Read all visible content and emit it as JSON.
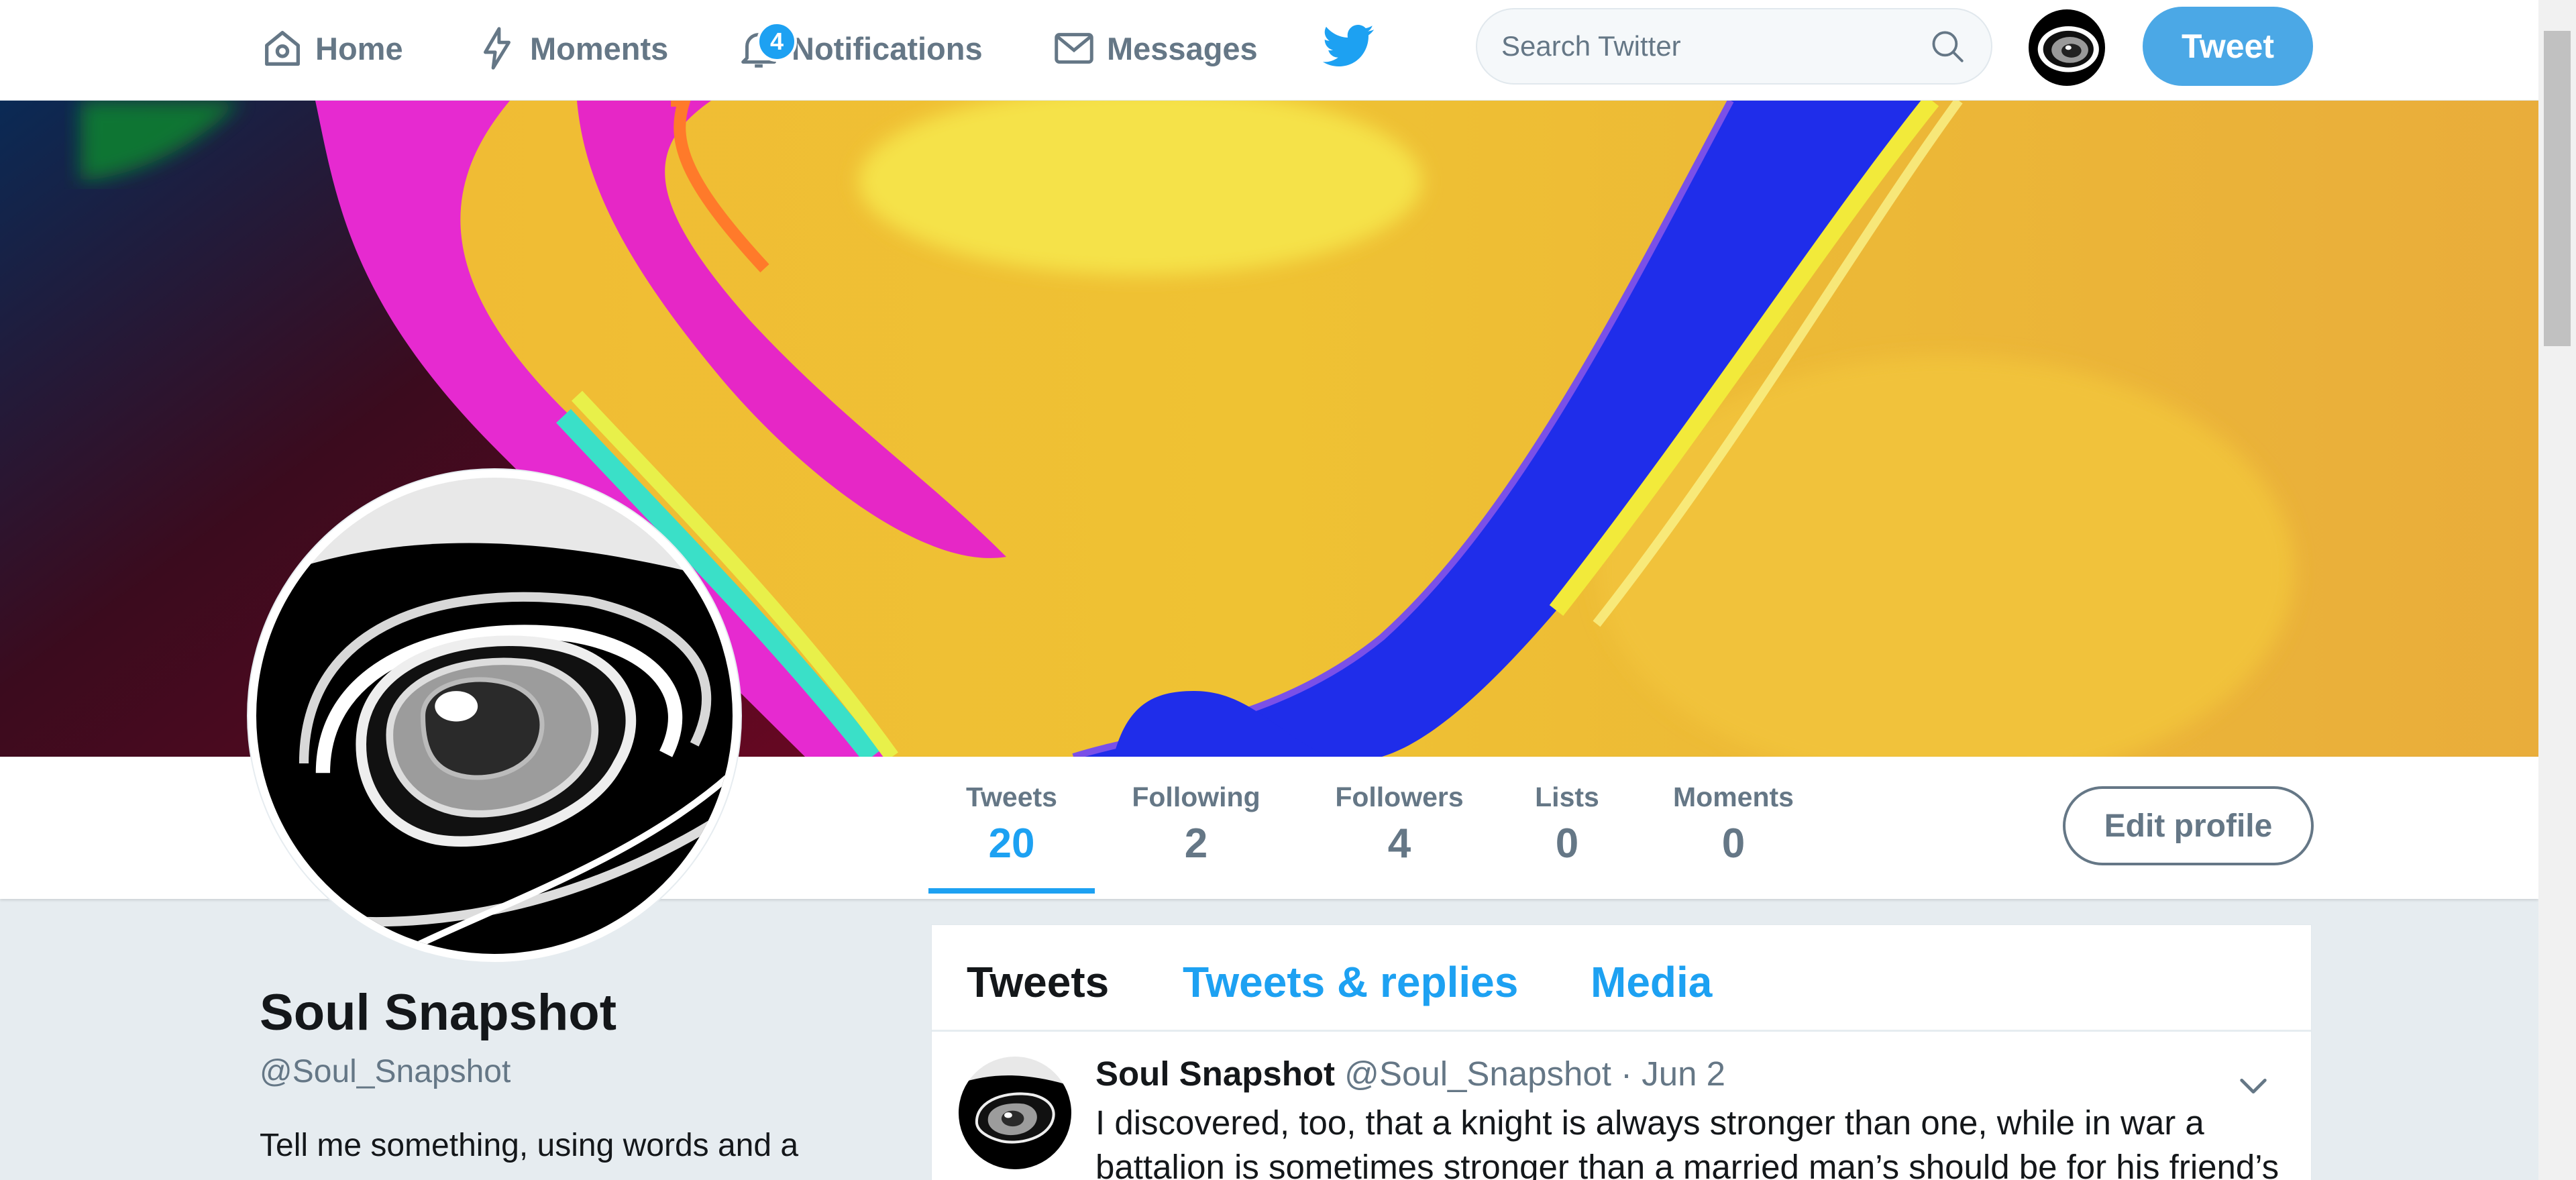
{
  "nav": {
    "home": "Home",
    "moments": "Moments",
    "notifications": "Notifications",
    "notifications_count": "4",
    "messages": "Messages",
    "search_placeholder": "Search Twitter",
    "tweet_button": "Tweet"
  },
  "icons": {
    "home": "home-icon",
    "moments": "lightning-icon",
    "notifications": "bell-icon",
    "messages": "envelope-icon",
    "logo": "twitter-bird-icon",
    "search": "magnifier-icon",
    "more": "chevron-down-icon"
  },
  "colors": {
    "accent": "#1da1f2",
    "tweet_button": "#4ba8e6",
    "muted": "#657786",
    "page_background": "#e6ecf0",
    "banner_main": "#ebb033",
    "banner_blue": "#1f2dea",
    "banner_magenta": "#e31fc8"
  },
  "profile": {
    "name": "Soul Snapshot",
    "handle": "@Soul_Snapshot",
    "bio": "Tell me something, using words and a",
    "edit_button": "Edit profile"
  },
  "stats": [
    {
      "label": "Tweets",
      "value": "20"
    },
    {
      "label": "Following",
      "value": "2"
    },
    {
      "label": "Followers",
      "value": "4"
    },
    {
      "label": "Lists",
      "value": "0"
    },
    {
      "label": "Moments",
      "value": "0"
    }
  ],
  "timeline": {
    "tabs": [
      "Tweets",
      "Tweets & replies",
      "Media"
    ]
  },
  "tweet": {
    "name": "Soul Snapshot",
    "meta": "@Soul_Snapshot · Jun 2",
    "text": "I discovered, too, that a knight is always stronger than one, while in war a battalion is sometimes stronger than a married man’s should be for his friend’s"
  }
}
